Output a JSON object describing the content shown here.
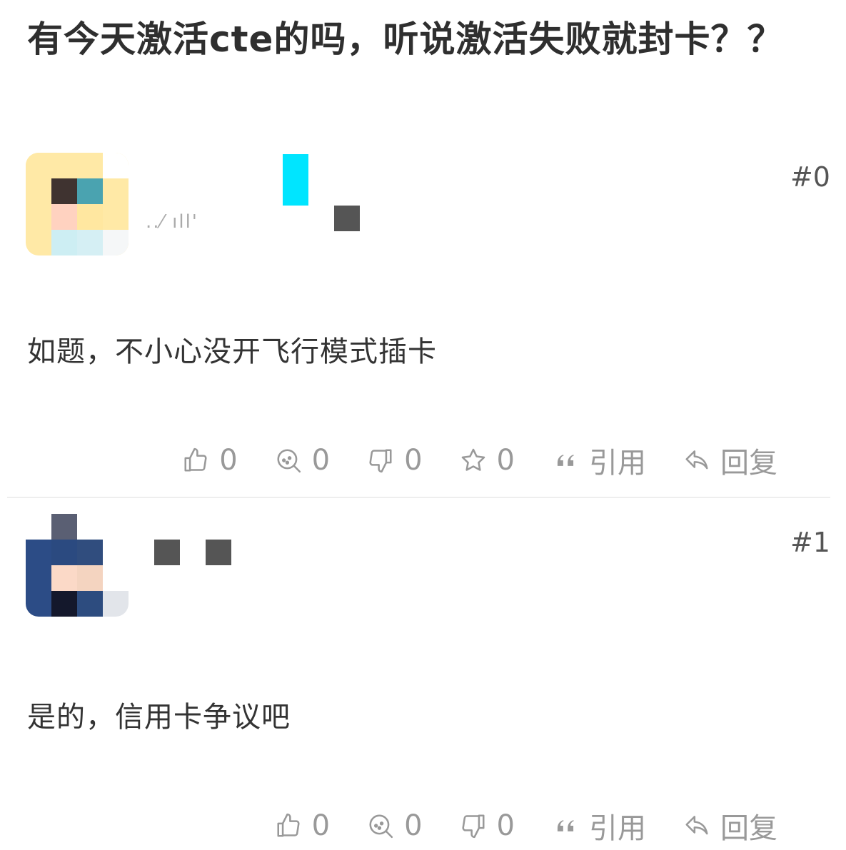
{
  "topic": {
    "title": "有今天激活cte的吗，听说激活失败就封卡？？"
  },
  "posts": [
    {
      "floor": "#0",
      "username_fragment": "..⁄ ıll'",
      "content": "如题，不小心没开飞行模式插卡",
      "actions": {
        "like": "0",
        "comment": "0",
        "dislike": "0",
        "star": "0",
        "quote": "引用",
        "reply": "回复"
      }
    },
    {
      "floor": "#1",
      "content": "是的，信用卡争议吧",
      "actions": {
        "like": "0",
        "comment": "0",
        "dislike": "0",
        "quote": "引用",
        "reply": "回复"
      }
    }
  ],
  "colors": {
    "title": "#2f2f2f",
    "text": "#333333",
    "muted": "#999999",
    "redaction": "#555555",
    "cyan_block": "#00e5ff"
  }
}
